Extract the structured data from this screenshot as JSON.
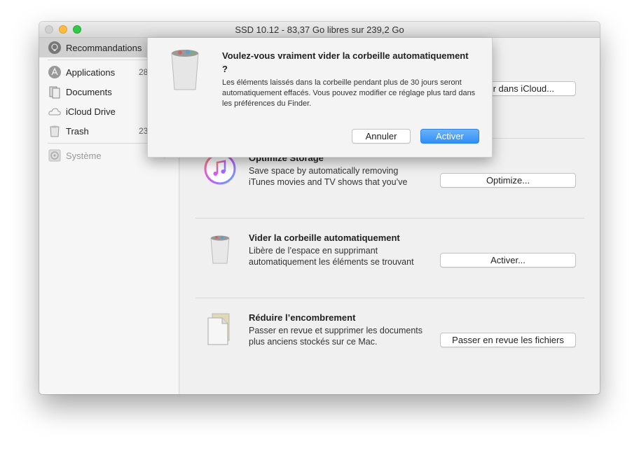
{
  "window": {
    "title": "SSD 10.12 - 83,37 Go libres sur 239,2 Go"
  },
  "sidebar": {
    "items": [
      {
        "label": "Recommandations",
        "icon": "lightbulb-icon",
        "count": ""
      },
      {
        "label": "Applications",
        "icon": "app-store-icon",
        "count": "28"
      },
      {
        "label": "Documents",
        "icon": "documents-icon",
        "count": ""
      },
      {
        "label": "iCloud Drive",
        "icon": "cloud-icon",
        "count": ""
      },
      {
        "label": "Trash",
        "icon": "trash-icon",
        "count": "23"
      },
      {
        "label": "Système",
        "icon": "system-disk-icon",
        "count": ""
      }
    ]
  },
  "main": {
    "store_button": "r dans iCloud...",
    "rows": [
      {
        "title": "Optimize Storage",
        "desc": "Save space by automatically removing iTunes movies and TV shows that you’ve",
        "button": "Optimize...",
        "icon": "itunes-icon"
      },
      {
        "title": "Vider la corbeille automatiquement",
        "desc": "Libère de l’espace en supprimant automatiquement les éléments se trouvant",
        "button": "Activer...",
        "icon": "trash-icon"
      },
      {
        "title": "Réduire l’encombrement",
        "desc": "Passer en revue et supprimer les documents plus anciens stockés sur ce Mac.",
        "button": "Passer en revue les fichiers",
        "icon": "document-icon"
      }
    ]
  },
  "dialog": {
    "title": "Voulez-vous vraiment vider la corbeille automatiquement ?",
    "message": "Les éléments laissés dans la corbeille pendant plus de 30 jours seront automatiquement effacés. Vous pouvez modifier ce réglage plus tard dans les préférences du Finder.",
    "cancel": "Annuler",
    "confirm": "Activer"
  },
  "colors": {
    "accent": "#2f8ff6",
    "close": "#d0d0d0",
    "minimize": "#fdbc40",
    "zoom": "#34c84a"
  }
}
